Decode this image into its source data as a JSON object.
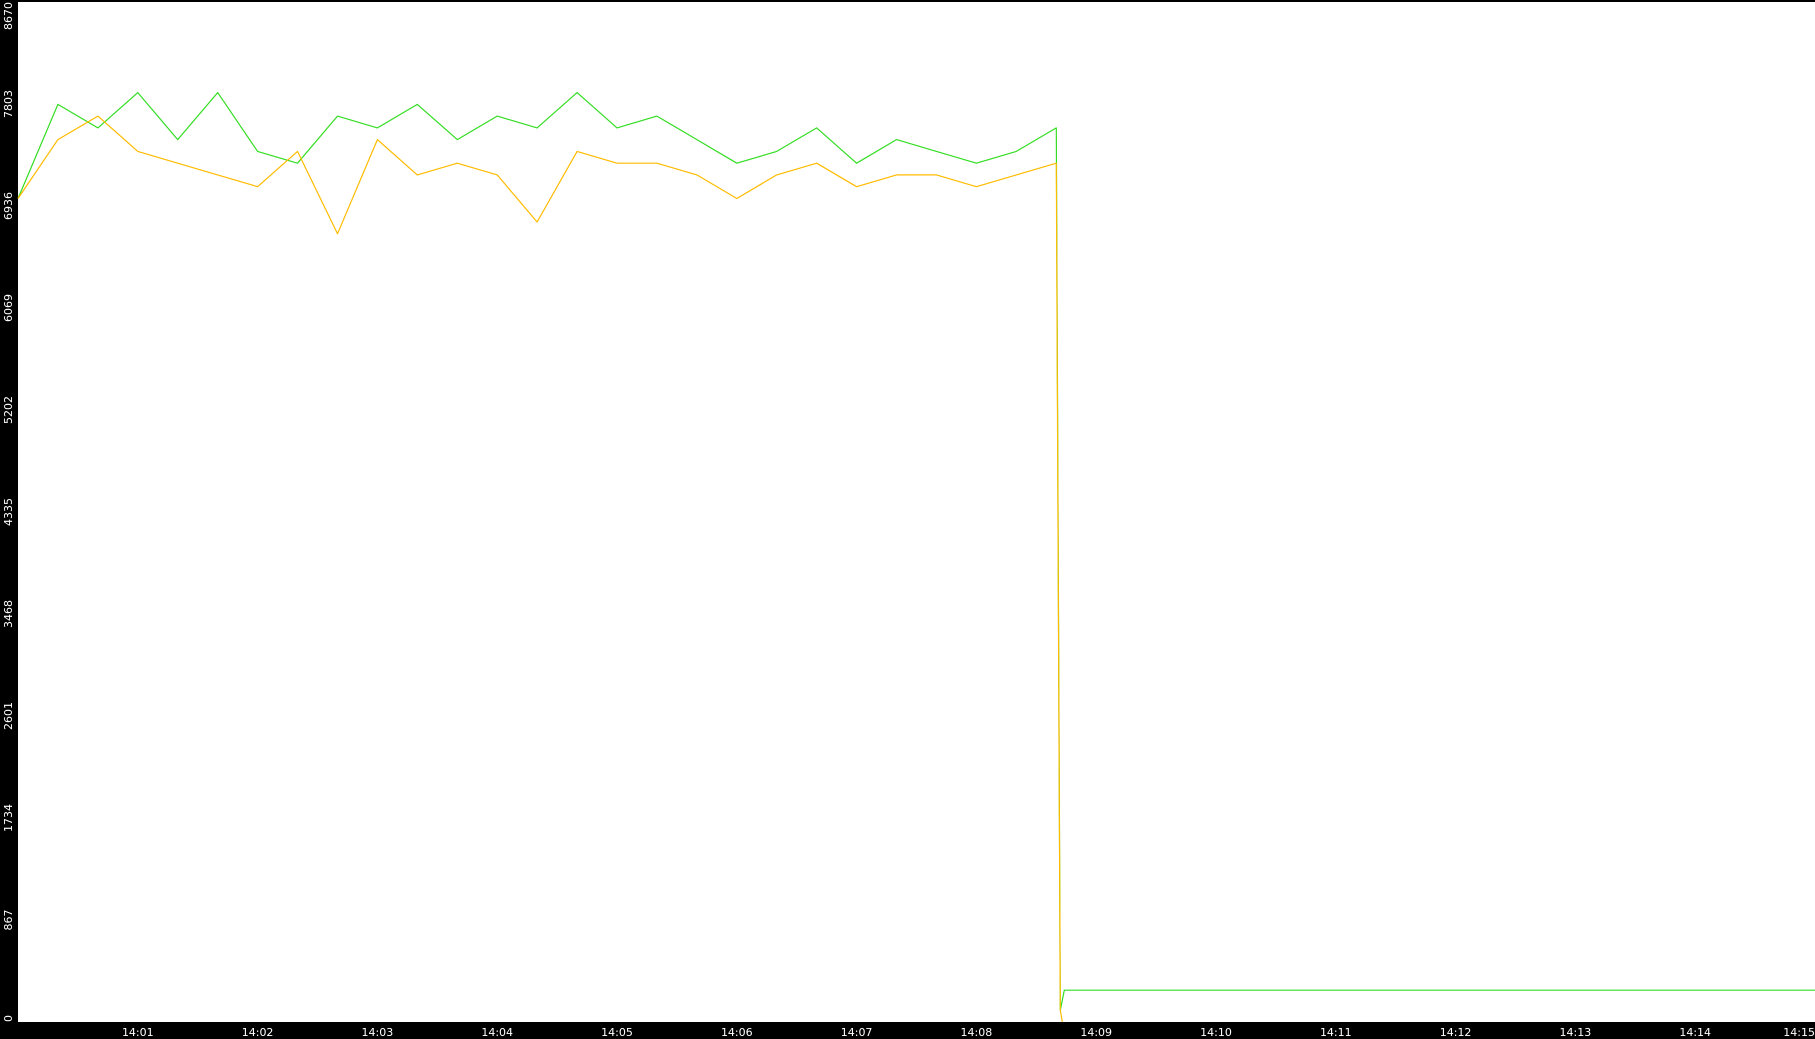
{
  "chart_data": {
    "type": "line",
    "title": "",
    "xlabel": "",
    "ylabel": "",
    "grid": false,
    "legend": "none",
    "colors": {
      "background": "#ffffff",
      "frame": "#000000",
      "tick_text": "#ffffff"
    },
    "xlim": [
      "14:00:00",
      "14:15:00"
    ],
    "ylim": [
      0,
      8670
    ],
    "x_ticks": [
      "14:01",
      "14:02",
      "14:03",
      "14:04",
      "14:05",
      "14:06",
      "14:07",
      "14:08",
      "14:09",
      "14:10",
      "14:11",
      "14:12",
      "14:13",
      "14:14",
      "14:15"
    ],
    "y_ticks": [
      "0",
      "867",
      "1734",
      "2601",
      "3468",
      "4335",
      "5202",
      "6069",
      "6936",
      "7803",
      "8670"
    ],
    "series": [
      {
        "color": "#33dd22",
        "x": [
          "14:00:00",
          "14:00:20",
          "14:00:40",
          "14:01:00",
          "14:01:20",
          "14:01:40",
          "14:02:00",
          "14:02:20",
          "14:02:40",
          "14:03:00",
          "14:03:20",
          "14:03:40",
          "14:04:00",
          "14:04:20",
          "14:04:40",
          "14:05:00",
          "14:05:20",
          "14:05:40",
          "14:06:00",
          "14:06:20",
          "14:06:40",
          "14:07:00",
          "14:07:20",
          "14:07:40",
          "14:08:00",
          "14:08:20",
          "14:08:40",
          "14:08:42",
          "14:08:44",
          "14:15:00"
        ],
        "values": [
          7000,
          7800,
          7600,
          7900,
          7500,
          7900,
          7400,
          7300,
          7700,
          7600,
          7800,
          7500,
          7700,
          7600,
          7900,
          7600,
          7700,
          7500,
          7300,
          7400,
          7600,
          7300,
          7500,
          7400,
          7300,
          7400,
          7600,
          100,
          270,
          270
        ]
      },
      {
        "color": "#ffbb00",
        "x": [
          "14:00:00",
          "14:00:20",
          "14:00:40",
          "14:01:00",
          "14:01:20",
          "14:01:40",
          "14:02:00",
          "14:02:20",
          "14:02:40",
          "14:03:00",
          "14:03:20",
          "14:03:40",
          "14:04:00",
          "14:04:20",
          "14:04:40",
          "14:05:00",
          "14:05:20",
          "14:05:40",
          "14:06:00",
          "14:06:20",
          "14:06:40",
          "14:07:00",
          "14:07:20",
          "14:07:40",
          "14:08:00",
          "14:08:20",
          "14:08:40",
          "14:08:41",
          "14:08:42",
          "14:08:43"
        ],
        "values": [
          7000,
          7500,
          7700,
          7400,
          7300,
          7200,
          7100,
          7400,
          6700,
          7500,
          7200,
          7300,
          7200,
          6800,
          7400,
          7300,
          7300,
          7200,
          7000,
          7200,
          7300,
          7100,
          7200,
          7200,
          7100,
          7200,
          7300,
          3700,
          100,
          0
        ]
      }
    ]
  }
}
